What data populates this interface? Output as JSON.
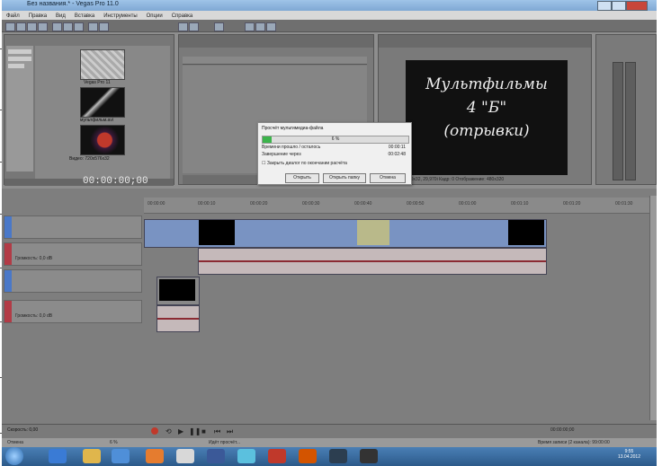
{
  "window": {
    "title": "Без названия.* - Vegas Pro 11.0"
  },
  "menu": [
    "Файл",
    "Правка",
    "Вид",
    "Вставка",
    "Инструменты",
    "Опции",
    "Справка"
  ],
  "explorer": {
    "items": [
      {
        "label": "Vegas Pro 11.0"
      },
      {
        "label": "Без названия.veg"
      }
    ]
  },
  "preview": {
    "title_lines": [
      "Мультфильмы",
      "4 \"Б\"",
      "(отрывки)"
    ],
    "status": "Проект: 720x480x32, 29,970i   Кадр: 0   Отображение: 480x320"
  },
  "timeline": {
    "timecode": "00:00:00;00",
    "ruler_labels": [
      "00:00:00",
      "00:00:10",
      "00:00:20",
      "00:00:30",
      "00:00:40",
      "00:00:50",
      "00:01:00",
      "00:01:10",
      "00:01:20",
      "00:01:30"
    ],
    "track_labels": [
      "Громкость: 0,0 dB",
      "Баланс: Центр",
      "Громкость: 0,0 dB",
      "Баланс: Центр"
    ]
  },
  "dialog": {
    "title": "Просчёт мультимедиа-файла",
    "progress_percent": 6,
    "progress_label": "6 %",
    "rows": [
      {
        "label": "Времени прошло / осталось",
        "value": "00:00:11"
      },
      {
        "label": "Завершение через",
        "value": "00:02:48"
      }
    ],
    "checkbox_label": "Закрыть диалог по окончании расчёта",
    "buttons": [
      "Открыть",
      "Открыть папку",
      "Отмена"
    ]
  },
  "transport": {
    "rate": "Скорость: 0,00",
    "timecode_right": "00:00:00;00"
  },
  "statusbar": {
    "left": "Отмена",
    "progress": "6 %",
    "center": "Идёт просчёт...",
    "right": "Время записи (2 канала): 99:00:00"
  },
  "taskbar": {
    "time": "9:55",
    "date": "13.04.2012"
  }
}
